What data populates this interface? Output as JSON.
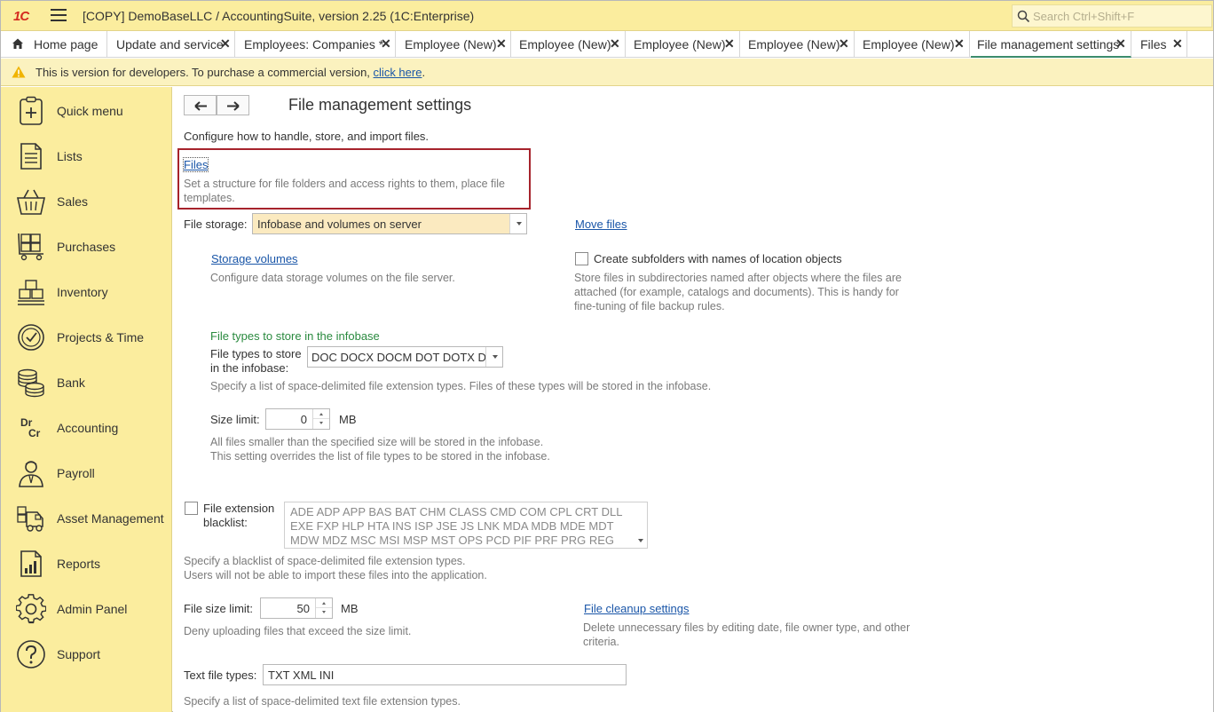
{
  "app": {
    "logo": "1С",
    "title": "[COPY] DemoBaseLLC / AccountingSuite, version 2.25  (1C:Enterprise)",
    "search_placeholder": "Search Ctrl+Shift+F"
  },
  "tabs": [
    {
      "label": "Home page"
    },
    {
      "label": "Update and service",
      "close": "✕"
    },
    {
      "label": "Employees: Companies *",
      "close": "✕"
    },
    {
      "label": "Employee (New)",
      "close": "✕"
    },
    {
      "label": "Employee (New)",
      "close": "✕"
    },
    {
      "label": "Employee (New)",
      "close": "✕"
    },
    {
      "label": "Employee (New)",
      "close": "✕"
    },
    {
      "label": "Employee (New)",
      "close": "✕"
    },
    {
      "label": "File management settings",
      "close": "✕"
    },
    {
      "label": "Files",
      "close": "✕"
    }
  ],
  "warning": {
    "text": "This is version for developers. To purchase a commercial version,",
    "link": "click here",
    "suffix": "."
  },
  "sidebar": {
    "items": [
      {
        "label": "Quick menu",
        "icon": "quick-menu-icon"
      },
      {
        "label": "Lists",
        "icon": "lists-icon"
      },
      {
        "label": "Sales",
        "icon": "sales-basket-icon"
      },
      {
        "label": "Purchases",
        "icon": "purchases-cart-icon"
      },
      {
        "label": "Inventory",
        "icon": "inventory-boxes-icon"
      },
      {
        "label": "Projects & Time",
        "icon": "projects-clock-icon"
      },
      {
        "label": "Bank",
        "icon": "bank-coins-icon"
      },
      {
        "label": "Accounting",
        "icon": "accounting-drcr-icon",
        "glyph_dr": "Dr",
        "glyph_cr": "Cr"
      },
      {
        "label": "Payroll",
        "icon": "payroll-person-icon"
      },
      {
        "label": "Asset Management",
        "icon": "asset-truck-icon"
      },
      {
        "label": "Reports",
        "icon": "reports-chart-icon"
      },
      {
        "label": "Admin Panel",
        "icon": "gear-icon"
      },
      {
        "label": "Support",
        "icon": "question-icon"
      }
    ]
  },
  "page": {
    "title": "File management settings",
    "description": "Configure how to handle, store, and import files.",
    "files_link": "Files",
    "files_hint_1": "Set a structure for file folders and access rights to them, place file",
    "files_hint_2": "templates.",
    "file_storage_label": "File storage:",
    "file_storage_value": "Infobase and volumes on server",
    "move_files_link": "Move files",
    "storage_volumes_link": "Storage volumes",
    "storage_volumes_hint": "Configure data storage volumes on the file server.",
    "subfolders_label": "Create subfolders with names of location objects",
    "subfolders_hint_1": "Store files in subdirectories named after objects where the files are",
    "subfolders_hint_2": "attached (for example, catalogs and documents). This is handy for",
    "subfolders_hint_3": "fine-tuning of file backup rules.",
    "types_group_title": "File types to store in the infobase",
    "types_label_1": "File types to store",
    "types_label_2": "in the infobase:",
    "types_value": "DOC DOCX DOCM DOT DOTX D",
    "types_hint": "Specify a list of space-delimited file extension types. Files of these types will be stored in the infobase.",
    "size_limit_label": "Size limit:",
    "size_limit_value": "0",
    "size_limit_unit": "MB",
    "size_hint_1": "All files smaller than the specified size will be stored in the infobase.",
    "size_hint_2": "This setting overrides the list of file types to be stored in the infobase.",
    "blacklist_label_1": "File extension",
    "blacklist_label_2": "blacklist:",
    "blacklist_value": "ADE ADP APP BAS BAT CHM CLASS CMD COM CPL CRT DLL EXE FXP HLP HTA INS ISP JSE JS LNK MDA MDB MDE MDT MDW MDZ MSC MSI MSP MST OPS PCD PIF PRF PRG REG",
    "blacklist_hint_1": "Specify a blacklist of space-delimited file extension types.",
    "blacklist_hint_2": "Users will not be able to import these files into the application.",
    "file_size_limit_label": "File size limit:",
    "file_size_limit_value": "50",
    "file_size_limit_unit": "MB",
    "file_size_hint": "Deny uploading files that exceed the size limit.",
    "cleanup_link": "File cleanup settings",
    "cleanup_hint_1": "Delete unnecessary files by editing date, file owner type, and other",
    "cleanup_hint_2": "criteria.",
    "text_types_label": "Text file types:",
    "text_types_value": "TXT XML INI",
    "text_types_hint": "Specify a list of space-delimited text file extension types."
  },
  "colors": {
    "header_bg": "#fbed9e",
    "sidebar_bg": "#fbed9e",
    "link": "#1a56a8",
    "highlight_border": "#a6232c",
    "group_title": "#2a8a3f",
    "active_tab_underline": "#3c8c6c"
  }
}
